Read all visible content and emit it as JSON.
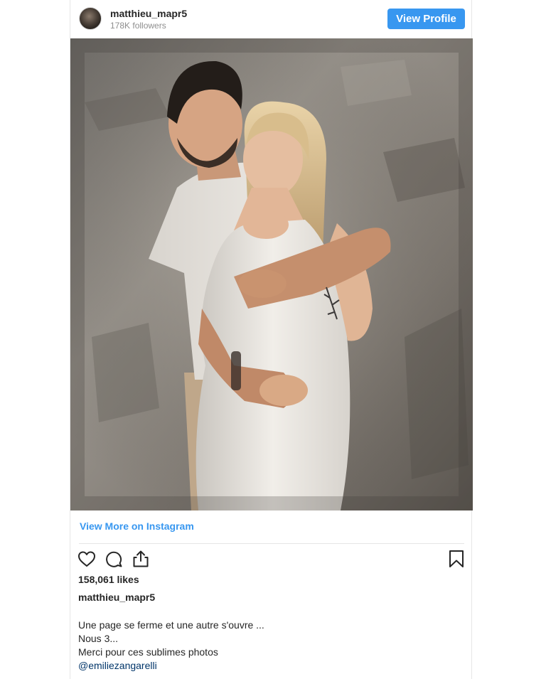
{
  "header": {
    "username": "matthieu_mapr5",
    "followers": "178K followers",
    "view_profile_label": "View Profile"
  },
  "post": {
    "image_icon": "photo",
    "view_more_label": "View More on Instagram",
    "actions": {
      "like_icon": "heart-icon",
      "comment_icon": "comment-icon",
      "share_icon": "share-icon",
      "save_icon": "bookmark-icon"
    },
    "likes": "158,061 likes",
    "caption_user": "matthieu_mapr5",
    "caption_lines": [
      "Une page se ferme et une autre s'ouvre ...",
      "Nous 3...",
      "Merci pour ces sublimes photos"
    ],
    "mention": "@emiliezangarelli"
  },
  "colors": {
    "accent": "#3897f0",
    "text": "#262626",
    "muted": "#8e8e8e",
    "mention": "#003569"
  }
}
